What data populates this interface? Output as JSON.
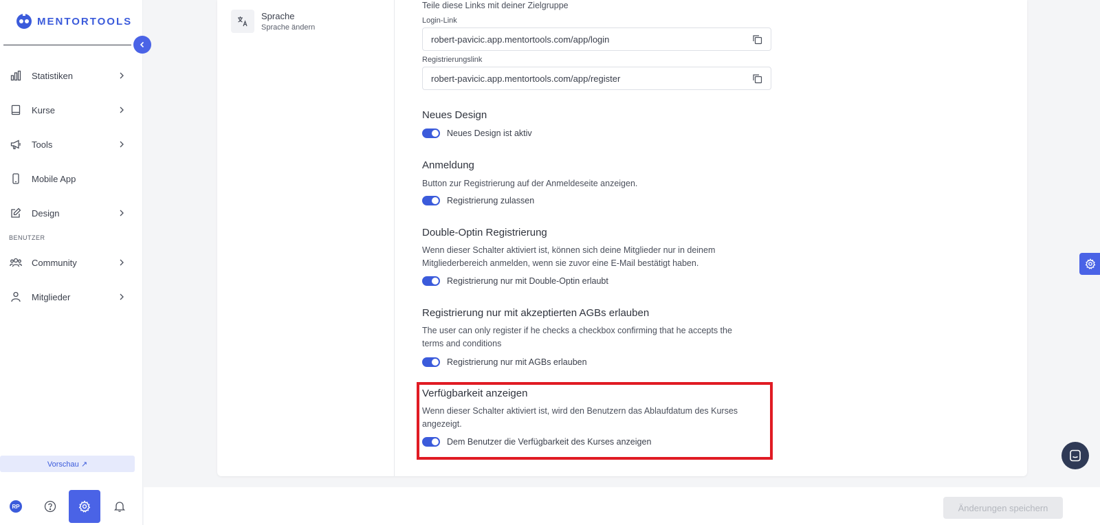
{
  "sidebar": {
    "logo_text": "MENTORTOOLS",
    "items": [
      {
        "label": "Statistiken",
        "icon": "bar-chart-icon",
        "has_chevron": true
      },
      {
        "label": "Kurse",
        "icon": "book-icon",
        "has_chevron": true
      },
      {
        "label": "Tools",
        "icon": "megaphone-icon",
        "has_chevron": true
      },
      {
        "label": "Mobile App",
        "icon": "phone-icon",
        "has_chevron": false
      },
      {
        "label": "Design",
        "icon": "edit-icon",
        "has_chevron": true
      }
    ],
    "section_benutzer": "BENUTZER",
    "items_benutzer": [
      {
        "label": "Community",
        "icon": "users-icon",
        "has_chevron": true
      },
      {
        "label": "Mitglieder",
        "icon": "user-icon",
        "has_chevron": true
      }
    ],
    "preview_label": "Vorschau ↗",
    "avatar_initials": "RP"
  },
  "settings_menu": {
    "language_title": "Sprache",
    "language_subtitle": "Sprache ändern"
  },
  "links": {
    "intro": "Teile diese Links mit deiner Zielgruppe",
    "login_label": "Login-Link",
    "login_value": "robert-pavicic.app.mentortools.com/app/login",
    "register_label": "Registrierungslink",
    "register_value": "robert-pavicic.app.mentortools.com/app/register"
  },
  "sections": {
    "new_design": {
      "title": "Neues Design",
      "toggle_label": "Neues Design ist aktiv",
      "enabled": true
    },
    "login": {
      "title": "Anmeldung",
      "description": "Button zur Registrierung auf der Anmeldeseite anzeigen.",
      "toggle_label": "Registrierung zulassen",
      "enabled": true
    },
    "double_optin": {
      "title": "Double-Optin Registrierung",
      "description_1": "Wenn dieser Schalter aktiviert ist, können sich deine Mitglieder nur in deinem",
      "description_2": "Mitgliederbereich anmelden, wenn sie zuvor eine E-Mail bestätigt haben.",
      "toggle_label": "Registrierung nur mit Double-Optin erlaubt",
      "enabled": true
    },
    "terms": {
      "title": "Registrierung nur mit akzeptierten AGBs erlauben",
      "description_1": "The user can only register if he checks a checkbox confirming that he accepts the",
      "description_2": "terms and conditions",
      "toggle_label": "Registrierung nur mit AGBs erlauben",
      "enabled": true
    },
    "availability": {
      "title": "Verfügbarkeit anzeigen",
      "description_1": "Wenn dieser Schalter aktiviert ist, wird den Benutzern das Ablaufdatum des Kurses",
      "description_2": "angezeigt.",
      "toggle_label": "Dem Benutzer die Verfügbarkeit des Kurses anzeigen",
      "enabled": true
    }
  },
  "bottom_bar": {
    "save_label": "Änderungen speichern"
  },
  "colors": {
    "accent": "#4a63e6",
    "highlight": "#e01b24"
  }
}
